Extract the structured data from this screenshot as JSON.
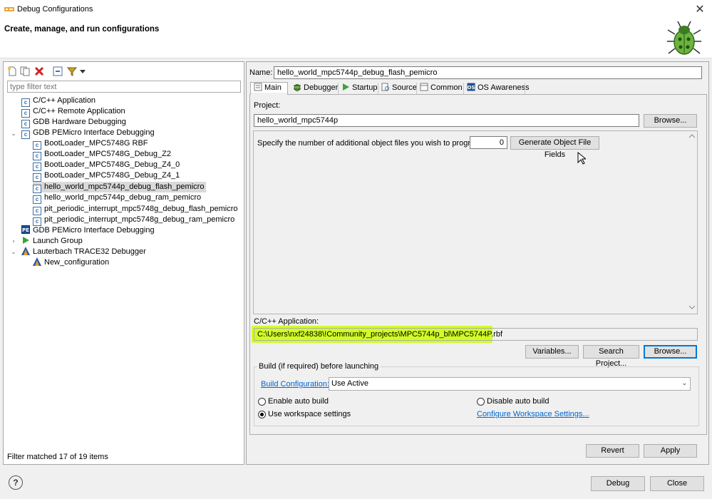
{
  "window": {
    "title": "Debug Configurations",
    "close_glyph": "✕"
  },
  "header": {
    "heading": "Create, manage, and run configurations"
  },
  "left": {
    "toolbar": [
      "new-config-icon",
      "duplicate-icon",
      "delete-icon",
      "collapse-all-icon",
      "filter-icon",
      "view-menu-icon"
    ],
    "filter_placeholder": "type filter text",
    "tree": [
      {
        "label": "C/C++ Application",
        "icon": "c-icon"
      },
      {
        "label": "C/C++ Remote Application",
        "icon": "c-icon"
      },
      {
        "label": "GDB Hardware Debugging",
        "icon": "c-icon"
      },
      {
        "label": "GDB PEMicro Interface Debugging",
        "icon": "c-icon"
      },
      {
        "label": "BootLoader_MPC5748G RBF",
        "icon": "c-icon"
      },
      {
        "label": "BootLoader_MPC5748G_Debug_Z2",
        "icon": "c-icon"
      },
      {
        "label": "BootLoader_MPC5748G_Debug_Z4_0",
        "icon": "c-icon"
      },
      {
        "label": "BootLoader_MPC5748G_Debug_Z4_1",
        "icon": "c-icon"
      },
      {
        "label": "hello_world_mpc5744p_debug_flash_pemicro",
        "icon": "c-icon"
      },
      {
        "label": "hello_world_mpc5744p_debug_ram_pemicro",
        "icon": "c-icon"
      },
      {
        "label": "pit_periodic_interrupt_mpc5748g_debug_flash_pemicro",
        "icon": "c-icon"
      },
      {
        "label": "pit_periodic_interrupt_mpc5748g_debug_ram_pemicro",
        "icon": "c-icon"
      },
      {
        "label": "GDB PEMicro Interface Debugging",
        "icon": "pe-icon"
      },
      {
        "label": "Launch Group",
        "icon": "launch-icon"
      },
      {
        "label": "Lauterbach TRACE32 Debugger",
        "icon": "trace32-icon"
      },
      {
        "label": "New_configuration",
        "icon": "trace32-icon"
      }
    ],
    "filter_status": "Filter matched 17 of 19 items"
  },
  "right": {
    "name_label": "Name:",
    "name_value": "hello_world_mpc5744p_debug_flash_pemicro",
    "tabs": [
      "Main",
      "Debugger",
      "Startup",
      "Source",
      "Common",
      "OS Awareness"
    ],
    "project_label": "Project:",
    "project_value": "hello_world_mpc5744p",
    "browse_label": "Browse...",
    "object_files_label": "Specify the number of additional object files you wish to program:",
    "object_files_value": "0",
    "generate_label": "Generate Object File Fields",
    "app_label": "C/C++ Application:",
    "app_value": "C:\\Users\\nxf24838\\!Community_projects\\MPC5744p_bl\\MPC5744P.rbf",
    "variables_label": "Variables...",
    "search_project_label": "Search Project...",
    "browse2_label": "Browse...",
    "build_group_label": "Build (if required) before launching",
    "build_config_link": "Build Configuration:",
    "build_config_value": "Use Active",
    "enable_auto_build": "Enable auto build",
    "disable_auto_build": "Disable auto build",
    "use_workspace_settings": "Use workspace settings",
    "configure_workspace_link": "Configure Workspace Settings...",
    "revert_label": "Revert",
    "apply_label": "Apply"
  },
  "footer": {
    "help_glyph": "?",
    "debug_label": "Debug",
    "close_label": "Close"
  },
  "colors": {
    "highlight": "#ccff00",
    "link": "#0066cc",
    "selection": "#d9d9d9"
  }
}
